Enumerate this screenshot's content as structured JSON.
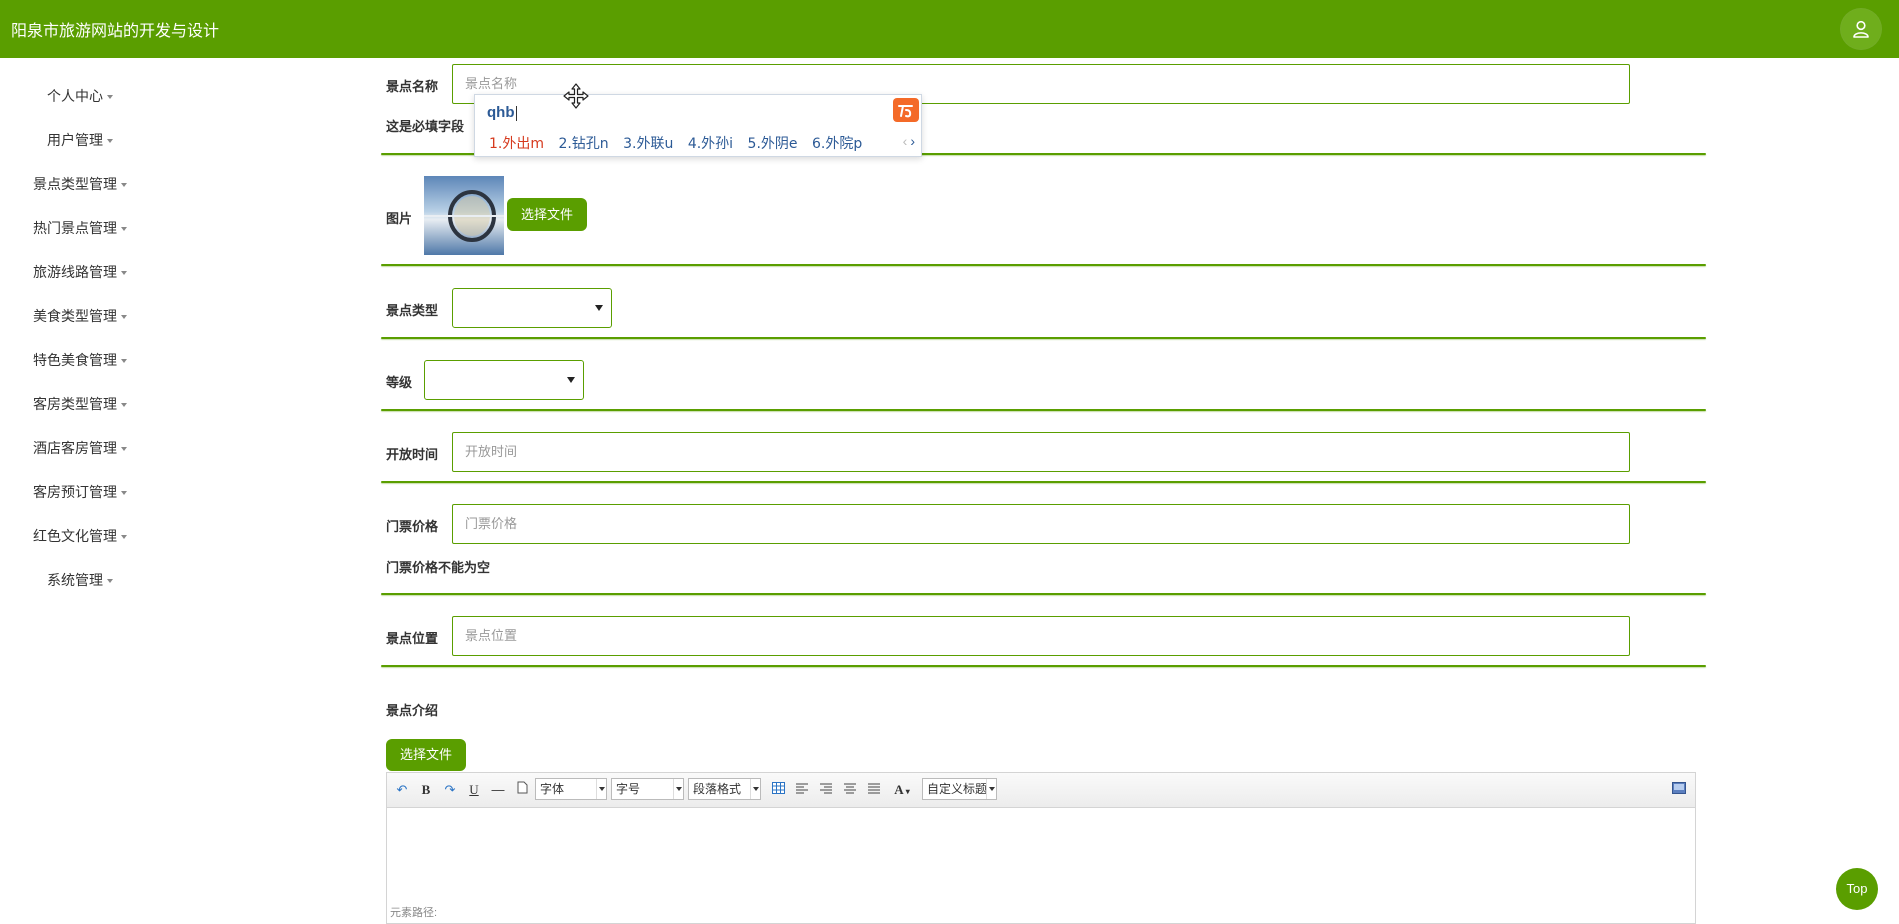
{
  "header": {
    "title": "阳泉市旅游网站的开发与设计"
  },
  "sidebar": {
    "items": [
      {
        "label": "个人中心"
      },
      {
        "label": "用户管理"
      },
      {
        "label": "景点类型管理"
      },
      {
        "label": "热门景点管理"
      },
      {
        "label": "旅游线路管理"
      },
      {
        "label": "美食类型管理"
      },
      {
        "label": "特色美食管理"
      },
      {
        "label": "客房类型管理"
      },
      {
        "label": "酒店客房管理"
      },
      {
        "label": "客房预订管理"
      },
      {
        "label": "红色文化管理"
      },
      {
        "label": "系统管理"
      }
    ]
  },
  "form": {
    "name": {
      "label": "景点名称",
      "placeholder": "景点名称",
      "error": "这是必填字段"
    },
    "image": {
      "label": "图片",
      "button": "选择文件"
    },
    "type": {
      "label": "景点类型",
      "value": ""
    },
    "level": {
      "label": "等级",
      "value": ""
    },
    "open_time": {
      "label": "开放时间",
      "placeholder": "开放时间"
    },
    "price": {
      "label": "门票价格",
      "placeholder": "门票价格",
      "error": "门票价格不能为空"
    },
    "location": {
      "label": "景点位置",
      "placeholder": "景点位置"
    },
    "intro": {
      "label": "景点介绍",
      "button": "选择文件"
    }
  },
  "ime": {
    "composition": "qhb",
    "candidates": [
      "1.外出m",
      "2.钻孔n",
      "3.外联u",
      "4.外孙i",
      "5.外阴e",
      "6.外院p"
    ],
    "prev": "‹",
    "next": "›"
  },
  "editor": {
    "toolbar": {
      "font_family": "字体",
      "font_size": "字号",
      "paragraph": "段落格式",
      "custom_title": "自定义标题",
      "bold": "B",
      "underline": "U",
      "font_color": "A"
    },
    "footer": "元素路径:"
  },
  "back_to_top": "Top",
  "colors": {
    "primary": "#5a9e00",
    "ime_accent": "#f46a28"
  }
}
